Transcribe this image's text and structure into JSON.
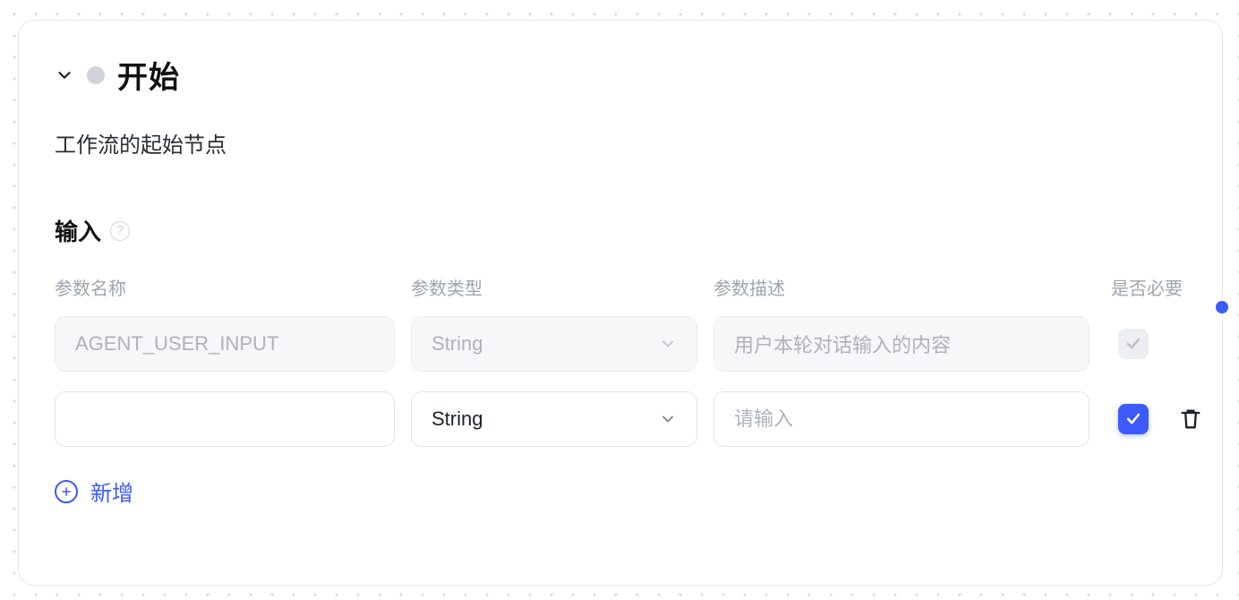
{
  "node": {
    "title": "开始",
    "description": "工作流的起始节点"
  },
  "section": {
    "input_label": "输入"
  },
  "columns": {
    "name": "参数名称",
    "type": "参数类型",
    "desc": "参数描述",
    "required": "是否必要"
  },
  "rows": [
    {
      "name": "AGENT_USER_INPUT",
      "type": "String",
      "desc": "用户本轮对话输入的内容",
      "required": true,
      "locked": true
    },
    {
      "name": "",
      "type": "String",
      "desc": "",
      "desc_placeholder": "请输入",
      "required": true,
      "locked": false
    }
  ],
  "actions": {
    "add_new": "新增"
  },
  "colors": {
    "accent": "#3d5afe"
  }
}
